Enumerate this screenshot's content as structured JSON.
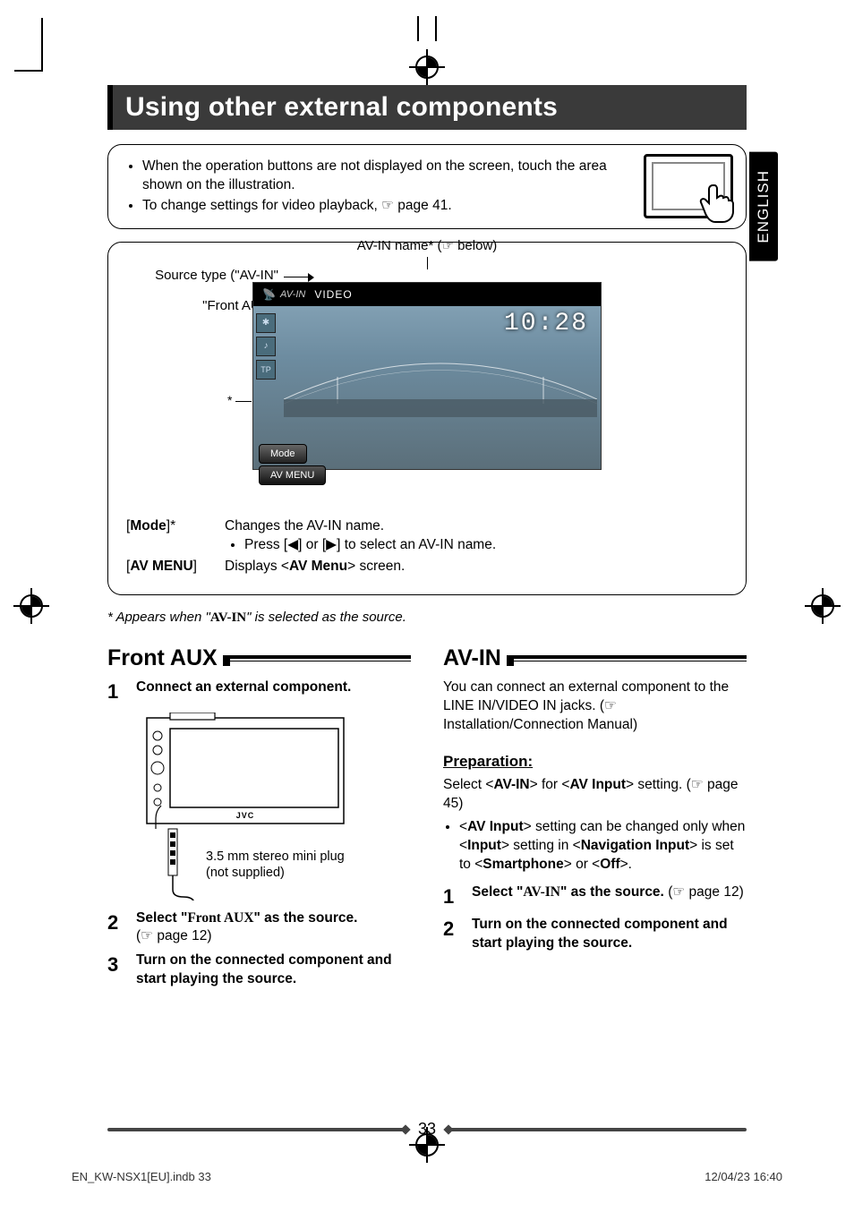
{
  "page_title": "Using other external components",
  "lang_tab": "ENGLISH",
  "tip_bullets": [
    "When the operation buttons are not displayed on the screen, touch the area shown on the illustration.",
    "To change settings for video playback, ☞ page 41."
  ],
  "callouts": {
    "top": "AV-IN name* (☞ below)",
    "left_a": "Source type (\"AV-IN\" or",
    "left_b": "\"Front AUX\")"
  },
  "asterisk_marker": "*",
  "screen": {
    "source_label": "AV-IN",
    "video_label": "VIDEO",
    "tp_label": "TP",
    "time": "10:28",
    "mode_btn": "Mode",
    "avmenu_btn": "AV MENU"
  },
  "legend": {
    "mode_key": "[Mode]*",
    "mode_val": "Changes the AV-IN name.",
    "mode_sub_pre": "Press [",
    "mode_sub_mid": "] or [",
    "mode_sub_post": "] to select an AV-IN name.",
    "avmenu_key": "[AV MENU]",
    "avmenu_val_pre": "Displays <",
    "avmenu_val_bold": "AV Menu",
    "avmenu_val_post": "> screen."
  },
  "footnote_pre": "*  Appears when \"",
  "footnote_bold": "AV-IN",
  "footnote_post": "\" is selected as the source.",
  "front_aux": {
    "title": "Front AUX",
    "step1": "Connect an external component.",
    "plug_line1": "3.5 mm stereo mini plug",
    "plug_line2": "(not supplied)",
    "jvc": "JVC",
    "step2_pre": "Select \"",
    "step2_bold": "Front AUX",
    "step2_post": "\" as the source.",
    "step2_ref": "(☞ page 12)",
    "step3": "Turn on the connected component and start playing the source."
  },
  "avin": {
    "title": "AV-IN",
    "intro": "You can connect an external component to the LINE IN/VIDEO IN jacks. (☞ Installation/Connection Manual)",
    "prep_label": "Preparation:",
    "prep_line_pre": "Select <",
    "prep_b1": "AV-IN",
    "prep_mid1": "> for <",
    "prep_b2": "AV Input",
    "prep_line_post": "> setting. (☞ page 45)",
    "prep_bullet_pre": "<",
    "prep_bullet_b1": "AV Input",
    "prep_bullet_m1": "> setting can be changed only when <",
    "prep_bullet_b2": "Input",
    "prep_bullet_m2": "> setting in <",
    "prep_bullet_b3": "Navigation Input",
    "prep_bullet_m3": "> is set to <",
    "prep_bullet_b4": "Smartphone",
    "prep_bullet_m4": "> or <",
    "prep_bullet_b5": "Off",
    "prep_bullet_post": ">.",
    "step1_pre": "Select \"",
    "step1_bold": "AV-IN",
    "step1_post": "\" as the source.",
    "step1_ref": "(☞ page 12)",
    "step2": "Turn on the connected component and start playing the source."
  },
  "page_number": "33",
  "print_file": "EN_KW-NSX1[EU].indb   33",
  "print_time": "12/04/23   16:40",
  "nums": {
    "n1": "1",
    "n2": "2",
    "n3": "3"
  }
}
